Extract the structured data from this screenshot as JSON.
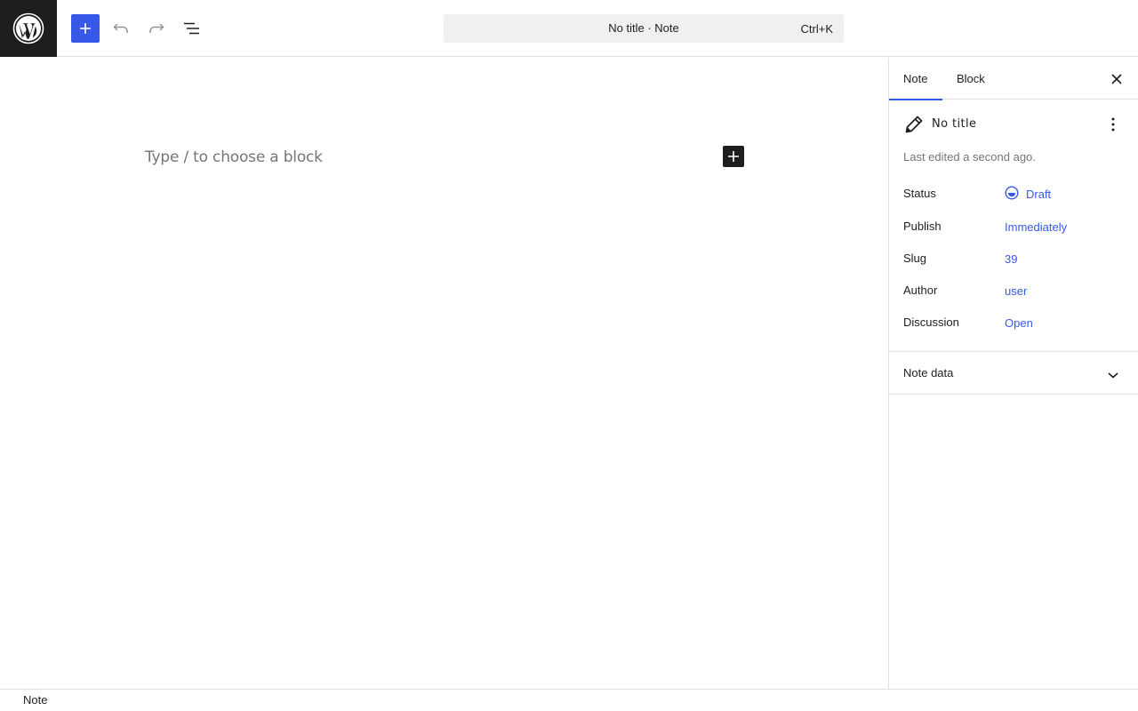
{
  "header": {
    "logo_icon": "wordpress-logo-icon",
    "add_block_icon": "plus-icon",
    "undo_icon": "undo-icon",
    "redo_icon": "redo-icon",
    "document_overview_icon": "list-view-icon",
    "command_title": "No title · Note",
    "command_shortcut": "Ctrl+K"
  },
  "editor": {
    "placeholder": "Type / to choose a block",
    "inline_add_icon": "plus-icon"
  },
  "sidebar": {
    "tabs": [
      {
        "label": "Note",
        "active": true
      },
      {
        "label": "Block",
        "active": false
      }
    ],
    "close_icon": "close-icon",
    "post": {
      "icon": "pencil-icon",
      "title": "No title",
      "menu_icon": "more-vertical-icon",
      "last_edited": "Last edited a second ago."
    },
    "properties": [
      {
        "label": "Status",
        "value": "Draft",
        "icon": "draft-status-icon"
      },
      {
        "label": "Publish",
        "value": "Immediately"
      },
      {
        "label": "Slug",
        "value": "39"
      },
      {
        "label": "Author",
        "value": "user"
      },
      {
        "label": "Discussion",
        "value": "Open"
      }
    ],
    "panel": {
      "title": "Note data",
      "icon": "chevron-down-icon"
    }
  },
  "footer": {
    "breadcrumb": "Note"
  },
  "colors": {
    "accent": "#3858e9",
    "dark": "#1e1e1e",
    "muted": "#757575",
    "border": "#e0e0e0",
    "command_bg": "#f0f0f0"
  }
}
